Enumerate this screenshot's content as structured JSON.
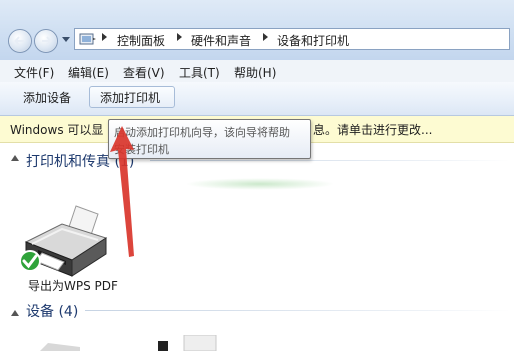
{
  "address_bar": {
    "breadcrumbs": [
      "控制面板",
      "硬件和声音",
      "设备和打印机"
    ]
  },
  "menu": [
    "文件(F)",
    "编辑(E)",
    "查看(V)",
    "工具(T)",
    "帮助(H)"
  ],
  "toolbar": {
    "add_device": "添加设备",
    "add_printer": "添加打印机"
  },
  "info_bar": {
    "left": "Windows 可以显",
    "right": "息。请单击进行更改..."
  },
  "tooltip": {
    "line1": "启动添加打印机向导，该向导将帮助",
    "line2": "安装打印机"
  },
  "groups": {
    "printers": {
      "title": "打印机和传真 (1)"
    },
    "devices": {
      "title": "设备 (4)"
    }
  },
  "printers": [
    {
      "name": "导出为WPS PDF",
      "default": true
    }
  ],
  "icons": {
    "back": "back-arrow-icon",
    "forward": "forward-arrow-icon",
    "control_panel": "control-panel-icon",
    "printer": "printer-icon",
    "default_check": "checkmark-icon"
  },
  "colors": {
    "info_bar_bg": "#fdfbd2",
    "group_title": "#1e3a6e",
    "annotation_arrow": "#d9352b",
    "default_check": "#2fa33a"
  }
}
